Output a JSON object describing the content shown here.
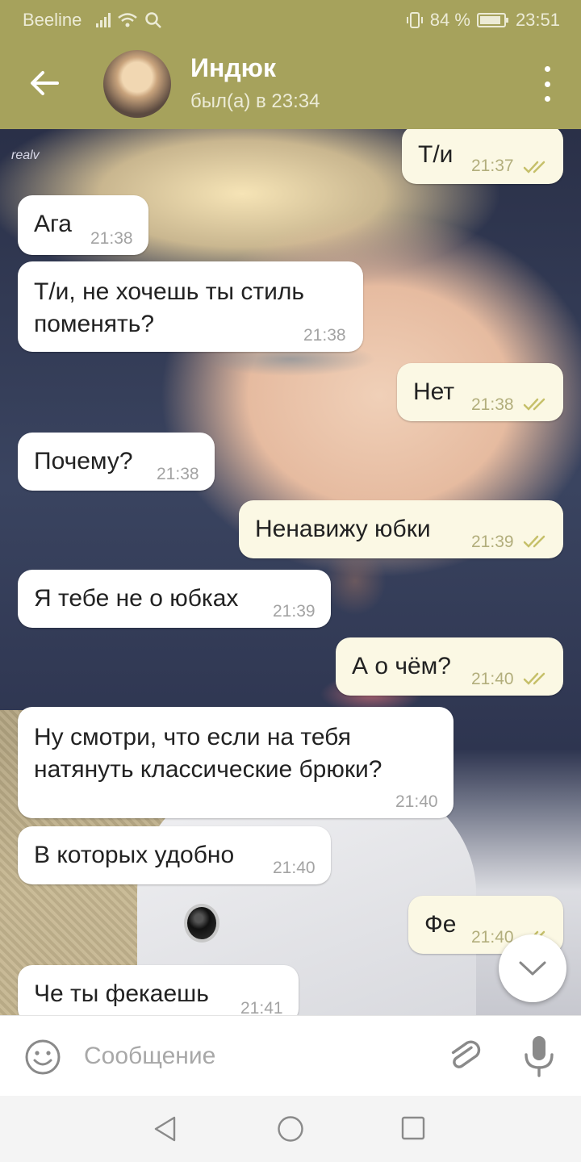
{
  "status_bar": {
    "carrier": "Beeline",
    "battery": "84 %",
    "time": "23:51"
  },
  "header": {
    "contact_name": "Индюк",
    "last_seen": "был(а) в 23:34",
    "watermark": "realv"
  },
  "messages": [
    {
      "dir": "out",
      "text": "Т/и",
      "time": "21:37",
      "status": "read"
    },
    {
      "dir": "in",
      "text": "Ага",
      "time": "21:38"
    },
    {
      "dir": "in",
      "lines": [
        "Т/и, не хочешь ты стиль",
        "поменять?"
      ],
      "time": "21:38"
    },
    {
      "dir": "out",
      "text": "Нет",
      "time": "21:38",
      "status": "read"
    },
    {
      "dir": "in",
      "text": "Почему?",
      "time": "21:38"
    },
    {
      "dir": "out",
      "text": "Ненавижу юбки",
      "time": "21:39",
      "status": "read"
    },
    {
      "dir": "in",
      "text": "Я тебе не о юбках",
      "time": "21:39"
    },
    {
      "dir": "out",
      "text": "А о чём?",
      "time": "21:40",
      "status": "read"
    },
    {
      "dir": "in",
      "lines": [
        "Ну смотри, что если на тебя",
        "натянуть классические брюки?"
      ],
      "time": "21:40"
    },
    {
      "dir": "in",
      "text": "В которых удобно",
      "time": "21:40"
    },
    {
      "dir": "out",
      "text": "Фе",
      "time": "21:40",
      "status": "read"
    },
    {
      "dir": "in",
      "text": "Че ты фекаешь",
      "time": "21:41"
    }
  ],
  "composer": {
    "placeholder": "Сообщение"
  },
  "colors": {
    "header": "#a6a25c",
    "outgoing_bubble": "#fbf8e4",
    "incoming_bubble": "#ffffff",
    "read_check": "#c6c06a"
  }
}
